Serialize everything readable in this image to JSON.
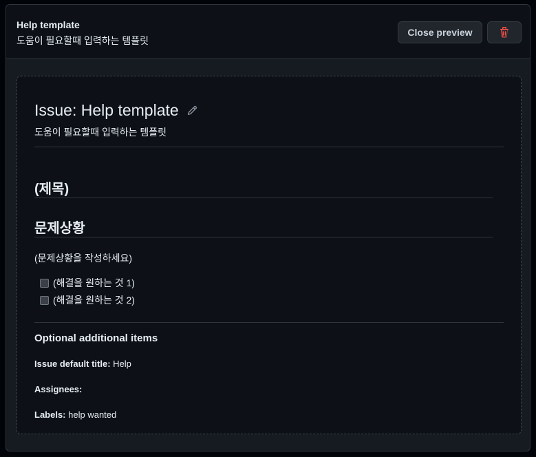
{
  "header": {
    "title": "Help template",
    "subtitle": "도움이 필요할때 입력하는 템플릿",
    "close_label": "Close preview",
    "delete_icon": "trash-icon"
  },
  "preview": {
    "issue_title": "Issue: Help template",
    "edit_icon": "pencil-icon",
    "issue_subtitle": "도움이 필요할때 입력하는 템플릿",
    "heading_title": "(제목)",
    "heading_problem": "문제상황",
    "problem_text": "(문제상황을 작성하세요)",
    "checklist": [
      "(해결을 원하는 것 1)",
      "(해결을 원하는 것 2)"
    ],
    "optional": {
      "title": "Optional additional items",
      "default_title_label": "Issue default title:",
      "default_title_value": "Help",
      "assignees_label": "Assignees:",
      "assignees_value": "",
      "labels_label": "Labels:",
      "labels_value": "help wanted"
    }
  },
  "colors": {
    "danger": "#f85149",
    "background": "#0d1117",
    "border": "#30363d"
  }
}
